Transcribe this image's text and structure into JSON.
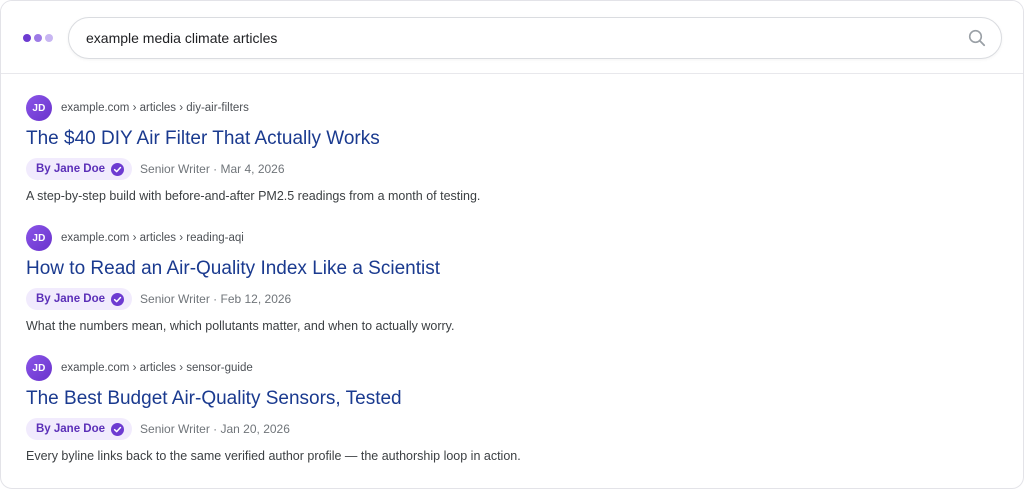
{
  "search": {
    "query": "example media climate articles"
  },
  "results": [
    {
      "avatar_initials": "JD",
      "cite": "example.com › articles › diy-air-filters",
      "title": "The $40 DIY Air Filter That Actually Works",
      "author": "By Jane Doe",
      "meta": "Senior Writer · Mar 4, 2026",
      "snippet": "A step-by-step build with before-and-after PM2.5 readings from a month of testing."
    },
    {
      "avatar_initials": "JD",
      "cite": "example.com › articles › reading-aqi",
      "title": "How to Read an Air-Quality Index Like a Scientist",
      "author": "By Jane Doe",
      "meta": "Senior Writer · Feb 12, 2026",
      "snippet": "What the numbers mean, which pollutants matter, and when to actually worry."
    },
    {
      "avatar_initials": "JD",
      "cite": "example.com › articles › sensor-guide",
      "title": "The Best Budget Air-Quality Sensors, Tested",
      "author": "By Jane Doe",
      "meta": "Senior Writer · Jan 20, 2026",
      "snippet": "Every byline links back to the same verified author profile — the authorship loop in action."
    }
  ],
  "icons": {
    "logo": "three-dots-logo",
    "search": "search-icon",
    "verified": "verified-check-icon"
  },
  "colors": {
    "accent": "#6d3bd1",
    "link": "#1a3a8f",
    "chip_bg": "#f1ebfd",
    "chip_text": "#5b2fb8"
  }
}
